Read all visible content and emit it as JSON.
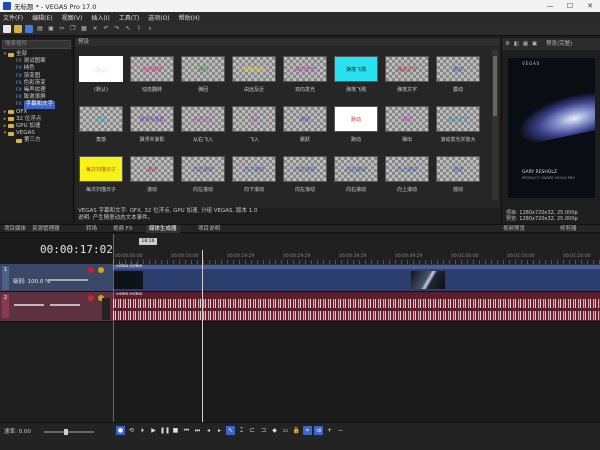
{
  "window": {
    "title": "无标题 * - VEGAS Pro 17.0",
    "controls": [
      "—",
      "☐",
      "✕"
    ]
  },
  "menu": [
    "文件(F)",
    "编辑(E)",
    "视图(V)",
    "插入(I)",
    "工具(T)",
    "选项(O)",
    "帮助(H)"
  ],
  "tree": {
    "search_placeholder": "搜索插件",
    "items": [
      {
        "label": "全部",
        "indent": 0,
        "type": "folder",
        "twist": "▾"
      },
      {
        "label": "测试图案",
        "indent": 1,
        "type": "fx"
      },
      {
        "label": "纯色",
        "indent": 1,
        "type": "fx"
      },
      {
        "label": "渐变图",
        "indent": 1,
        "type": "fx"
      },
      {
        "label": "色彩渐变",
        "indent": 1,
        "type": "fx"
      },
      {
        "label": "噪声纹理",
        "indent": 1,
        "type": "fx"
      },
      {
        "label": "致谢滚屏",
        "indent": 1,
        "type": "fx"
      },
      {
        "label": "字幕和文字",
        "indent": 1,
        "type": "fx",
        "selected": true
      },
      {
        "label": "OFX",
        "indent": 0,
        "type": "folder",
        "twist": "▸"
      },
      {
        "label": "32 位浮点",
        "indent": 0,
        "type": "folder",
        "twist": "▸"
      },
      {
        "label": "GPU 加速",
        "indent": 0,
        "type": "folder",
        "twist": "▸"
      },
      {
        "label": "VEGAS",
        "indent": 0,
        "type": "folder",
        "twist": "▾"
      },
      {
        "label": "第三方",
        "indent": 1,
        "type": "folder"
      }
    ]
  },
  "presets": {
    "breadcrumb": "预设",
    "tiles": [
      {
        "name": "(默认)",
        "text": "(默认)",
        "textcolor": "#dddddd",
        "bg": "#ffffff",
        "selected": true
      },
      {
        "name": "动态翻转",
        "text": "动态翻转",
        "textcolor": "#e23a7a"
      },
      {
        "name": "弹回",
        "text": "弹回",
        "textcolor": "#3aa13a"
      },
      {
        "name": "由远及近",
        "text": "由远及近",
        "textcolor": "#e6d82a"
      },
      {
        "name": "双向发光",
        "text": "双向发光",
        "textcolor": "#c13ac6"
      },
      {
        "name": "弹落飞溅",
        "text": "弹落飞溅",
        "textcolor": "#222222",
        "bg": "#28e2f0"
      },
      {
        "name": "弹落文字",
        "text": "弹落文字",
        "textcolor": "#c53a3a"
      },
      {
        "name": "震动",
        "text": "震动",
        "textcolor": "#3a54c8"
      },
      {
        "name": "角落",
        "text": "角落",
        "textcolor": "#3aa9c4"
      },
      {
        "name": "飘浮并渐影",
        "text": "飘浮并渐影",
        "textcolor": "#7a3ac8"
      },
      {
        "name": "从右飞入",
        "text": "从右飞入",
        "textcolor": "#c63abd"
      },
      {
        "name": "飞入",
        "text": "飞入",
        "textcolor": "#c83aa0"
      },
      {
        "name": "跳跃",
        "text": "跳跃",
        "textcolor": "#3a5fc8"
      },
      {
        "name": "跑动",
        "text": "跑动",
        "textcolor": "#d03a3a",
        "bg": "#ffffff"
      },
      {
        "name": "弹出",
        "text": "弹出",
        "textcolor": "#d03ad0"
      },
      {
        "name": "滚动发光并放大",
        "text": "滚动发光",
        "textcolor": "#3a9e9e"
      },
      {
        "name": "每次扫描日子",
        "text": "每次扫描日子",
        "textcolor": "#c83a3a",
        "bg": "#f7f31a"
      },
      {
        "name": "滚动",
        "text": "滚动",
        "textcolor": "#c83a3a"
      },
      {
        "name": "向左滚动",
        "text": "向左滚动",
        "textcolor": "#3a5fc8"
      },
      {
        "name": "向下滚动",
        "text": "向下滚动",
        "textcolor": "#3a5fc8"
      },
      {
        "name": "向左滚动",
        "text": "向左滚动",
        "textcolor": "#3a5fc8"
      },
      {
        "name": "向右滚动",
        "text": "向右滚动",
        "textcolor": "#3a5fc8"
      },
      {
        "name": "向上滚动",
        "text": "向上滚动",
        "textcolor": "#3a5fc8"
      },
      {
        "name": "摇动",
        "text": "摇动",
        "textcolor": "#3a5fc8"
      }
    ],
    "desc_line1": "VEGAS 字幕和文字: OFX, 32 位浮点, GPU 加速, 分组 VEGAS, 版本 1.0",
    "desc_line2": "说明: 产生随意动态文本事件。"
  },
  "preview": {
    "mode": "预览(完整)",
    "brand": "VEGAS",
    "person_name": "GARY RESHOLZ",
    "person_role": "PRODUCT OWNER VEGAS PRO",
    "project_info": "项目: 1280x720x32, 25.000p",
    "preview_info": "预览: 1280x720x32, 25.000p"
  },
  "tabs": [
    "项目媒体",
    "资源管理器",
    "转场",
    "视频 FX",
    "媒体生成器",
    "项目说明",
    "视频预览",
    "修剪器"
  ],
  "timeline": {
    "timecode": "00:00:17:02",
    "cursor_box": "18:16",
    "ruler_labels": [
      "00:00:00:00",
      "00:00:10:00",
      "00:00:19:29",
      "00:00:29:29",
      "00:00:39:29",
      "00:00:49:29",
      "00:01:00:00",
      "00:01:10:00",
      "00:01:20:00"
    ],
    "video_track": {
      "number": "1",
      "label": "级别: 100.0 %"
    },
    "audio_track": {
      "number": "2"
    },
    "clip_name": "video-index"
  },
  "bottom": {
    "rate": "速率: 0.00"
  }
}
